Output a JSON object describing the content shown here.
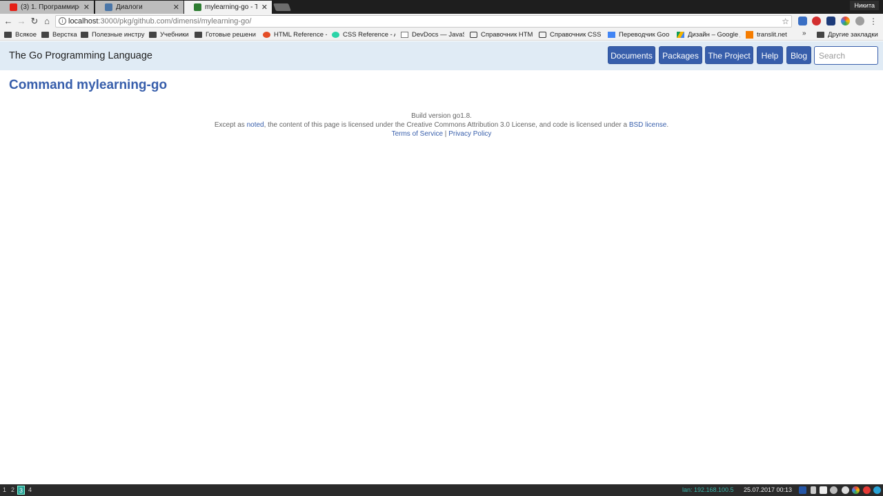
{
  "browser": {
    "tabs": [
      {
        "title": "(3) 1. Программиров",
        "favicon_color": "#e62117",
        "active": false
      },
      {
        "title": "Диалоги",
        "favicon_color": "#4a76a8",
        "active": false
      },
      {
        "title": "mylearning-go - The G",
        "favicon_color": "#2e7d32",
        "active": true
      }
    ],
    "profile": "Никита",
    "url_host": "localhost",
    "url_path": ":3000/pkg/github.com/dimensi/mylearning-go/",
    "bookmarks": [
      {
        "label": "Всякое",
        "icon": "folder"
      },
      {
        "label": "Верстка",
        "icon": "folder"
      },
      {
        "label": "Полезные инстру",
        "icon": "folder"
      },
      {
        "label": "Учебники",
        "icon": "folder"
      },
      {
        "label": "Готовые решени",
        "icon": "folder"
      },
      {
        "label": "HTML Reference - A",
        "icon": "html-icon"
      },
      {
        "label": "CSS Reference - A f",
        "icon": "css-icon"
      },
      {
        "label": "DevDocs — JavaSc",
        "icon": "devdocs-icon"
      },
      {
        "label": "Справочник HTM",
        "icon": "comment-icon"
      },
      {
        "label": "Справочник CSS |",
        "icon": "comment-icon"
      },
      {
        "label": "Переводчик Goo",
        "icon": "translate-icon"
      },
      {
        "label": "Дизайн – Google Д",
        "icon": "drive-icon"
      },
      {
        "label": "translit.net",
        "icon": "translit-icon"
      },
      {
        "label": "Другие закладки",
        "icon": "folder"
      }
    ]
  },
  "page": {
    "brand": "The Go Programming Language",
    "nav": [
      {
        "label": "Documents"
      },
      {
        "label": "Packages"
      },
      {
        "label": "The Project"
      },
      {
        "label": "Help"
      },
      {
        "label": "Blog"
      }
    ],
    "search_placeholder": "Search",
    "heading": "Command mylearning-go",
    "footer": {
      "build": "Build version go1.8.",
      "license_pre": "Except as ",
      "license_noted": "noted",
      "license_mid": ", the content of this page is licensed under the Creative Commons Attribution 3.0 License, and code is licensed under a ",
      "license_bsd": "BSD license",
      "license_end": ".",
      "terms": "Terms of Service",
      "sep": " | ",
      "privacy": "Privacy Policy"
    }
  },
  "taskbar": {
    "workspaces": [
      "1",
      "2",
      "3",
      "4"
    ],
    "active_workspace": "3",
    "network": "lan: 192.168.100.5",
    "clock": "25.07.2017 00:13"
  }
}
